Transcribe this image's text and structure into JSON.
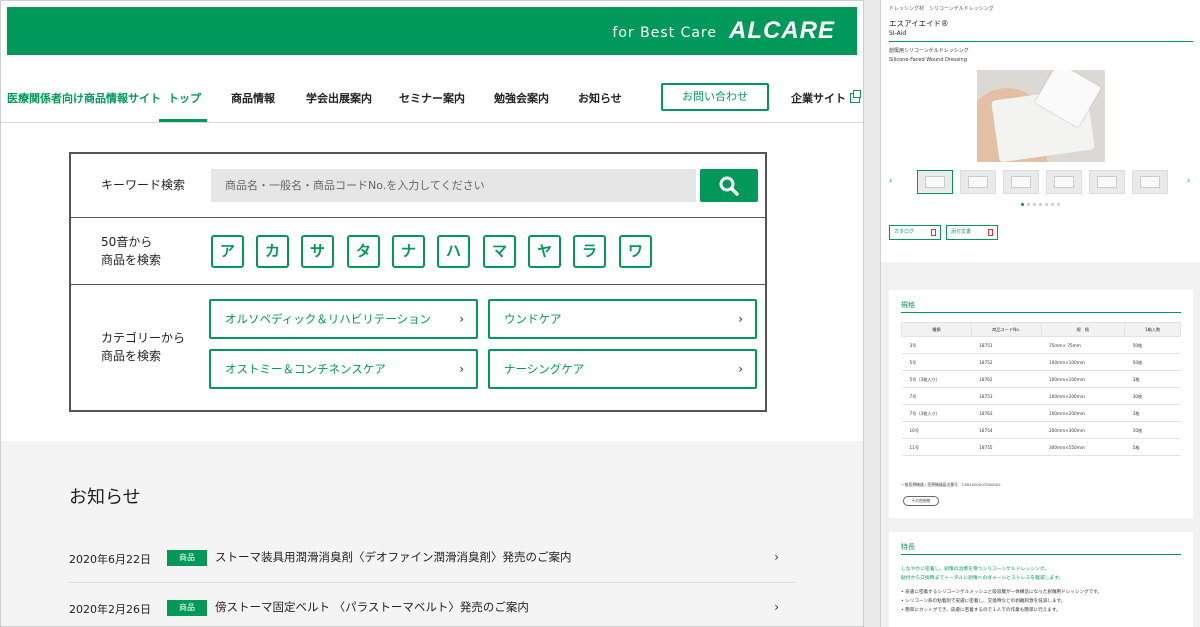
{
  "left": {
    "banner": {
      "tagline": "for Best Care",
      "logo": "ALCARE"
    },
    "nav": {
      "site_name": "医療関係者向け商品情報サイト",
      "items": [
        "トップ",
        "商品情報",
        "学会出展案内",
        "セミナー案内",
        "勉強会案内",
        "お知らせ"
      ],
      "contact_button": "お問い合わせ",
      "corporate_link": "企業サイト"
    },
    "search": {
      "keyword_label": "キーワード検索",
      "keyword_placeholder": "商品名・一般名・商品コードNo.を入力してください",
      "kana_label_1": "50音から",
      "kana_label_2": "商品を検索",
      "kana": [
        "ア",
        "カ",
        "サ",
        "タ",
        "ナ",
        "ハ",
        "マ",
        "ヤ",
        "ラ",
        "ワ"
      ],
      "category_label_1": "カテゴリーから",
      "category_label_2": "商品を検索",
      "categories": [
        "オルソペディック＆リハビリテーション",
        "ウンドケア",
        "オストミー＆コンチネンスケア",
        "ナーシングケア"
      ]
    },
    "news": {
      "title": "お知らせ",
      "items": [
        {
          "date": "2020年6月22日",
          "tag": "商品",
          "text": "ストーマ装具用潤滑消臭剤〈デオファイン潤滑消臭剤〉発売のご案内"
        },
        {
          "date": "2020年2月26日",
          "tag": "商品",
          "text": "傍ストーマ固定ベルト 〈パラストーマベルト〉発売のご案内"
        }
      ]
    }
  },
  "right": {
    "breadcrumb": "ドレッシング材　シリコーンゲルドレッシング",
    "product_name": "エスアイエイド®",
    "product_name_en": "SI-Aid",
    "desc": "創傷用シリコーンゲルドレッシング",
    "desc_en": "Silicone-Faced Wound Dressing",
    "buttons": [
      "カタログ",
      "添付文書"
    ],
    "spec": {
      "title": "規格",
      "headers": [
        "種類",
        "商品コードNo.",
        "規　格",
        "1箱入数"
      ],
      "rows": [
        [
          "3号",
          "18751",
          "75mm× 75mm",
          "50枚"
        ],
        [
          "5号",
          "18752",
          "100mm×100mm",
          "50枚"
        ],
        [
          "5号（3枚入り）",
          "18762",
          "100mm×100mm",
          "3枚"
        ],
        [
          "7号",
          "18753",
          "100mm×200mm",
          "30枚"
        ],
        [
          "7号（3枚入り）",
          "18763",
          "100mm×200mm",
          "3枚"
        ],
        [
          "10号",
          "18754",
          "200mm×300mm",
          "10枚"
        ],
        [
          "11号",
          "18755",
          "300mm×550mm",
          "5枚"
        ]
      ],
      "note": "一般医療機器 / 医療機器届出番号：13B1X00207000002",
      "more_button": "その他規格"
    },
    "features": {
      "title": "特長",
      "lead_1": "しなやかに密着し、創傷の治癒を保つシリコーンゲルドレッシング。",
      "lead_2": "貼付から交換時までトータルに創傷へのダメージとストレスを軽減します。",
      "list": [
        "• 皮膚に密着するシリコーンゲルメッシュと吸収層が一体構造になった創傷用ドレッシングです。",
        "• シリコーン系の粘着剤で皮膚に密着し、交換時などの剥離刺激を低減します。",
        "• 簡単にカットができ、皮膚に密着するので１人での作業も簡単に行えます。"
      ]
    }
  }
}
